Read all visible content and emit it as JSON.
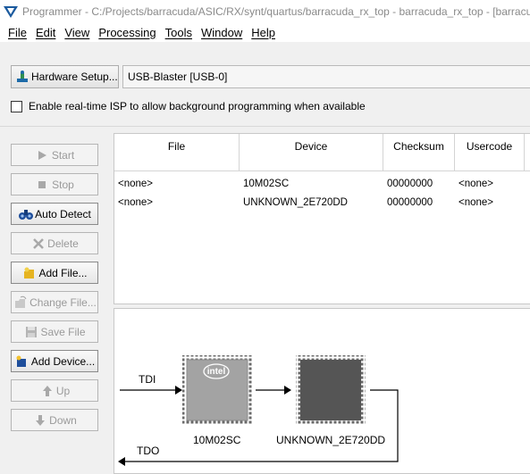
{
  "window": {
    "title": "Programmer - C:/Projects/barracuda/ASIC/RX/synt/quartus/barracuda_rx_top - barracuda_rx_top - [barracu"
  },
  "menu": [
    "File",
    "Edit",
    "View",
    "Processing",
    "Tools",
    "Window",
    "Help"
  ],
  "hardware": {
    "setup_button": "Hardware Setup...",
    "selected": "USB-Blaster [USB-0]"
  },
  "isp": {
    "label": "Enable real-time ISP to allow background programming when available",
    "checked": false
  },
  "buttons": [
    {
      "label": "Start",
      "enabled": false,
      "icon": "play-icon"
    },
    {
      "label": "Stop",
      "enabled": false,
      "icon": "stop-icon"
    },
    {
      "label": "Auto Detect",
      "enabled": true,
      "icon": "binoculars-icon"
    },
    {
      "label": "Delete",
      "enabled": false,
      "icon": "delete-x-icon"
    },
    {
      "label": "Add File...",
      "enabled": true,
      "icon": "add-file-icon"
    },
    {
      "label": "Change File...",
      "enabled": false,
      "icon": "change-file-icon"
    },
    {
      "label": "Save File",
      "enabled": false,
      "icon": "save-icon"
    },
    {
      "label": "Add Device...",
      "enabled": true,
      "icon": "add-device-icon"
    },
    {
      "label": "Up",
      "enabled": false,
      "icon": "up-arrow-icon"
    },
    {
      "label": "Down",
      "enabled": false,
      "icon": "down-arrow-icon"
    }
  ],
  "table": {
    "columns": [
      "File",
      "Device",
      "Checksum",
      "Usercode"
    ],
    "rows": [
      [
        "<none>",
        "10M02SC",
        "00000000",
        "<none>"
      ],
      [
        "<none>",
        "UNKNOWN_2E720DD",
        "00000000",
        "<none>"
      ]
    ]
  },
  "chain": {
    "tdi": "TDI",
    "tdo": "TDO",
    "chip_logo": "intel",
    "devices": [
      "10M02SC",
      "UNKNOWN_2E720DD"
    ]
  },
  "colors": {
    "chip_known": "#a3a3a3",
    "chip_unknown": "#555555",
    "title_text": "#8a8a8a",
    "app_icon_blue": "#1b5a9e"
  }
}
